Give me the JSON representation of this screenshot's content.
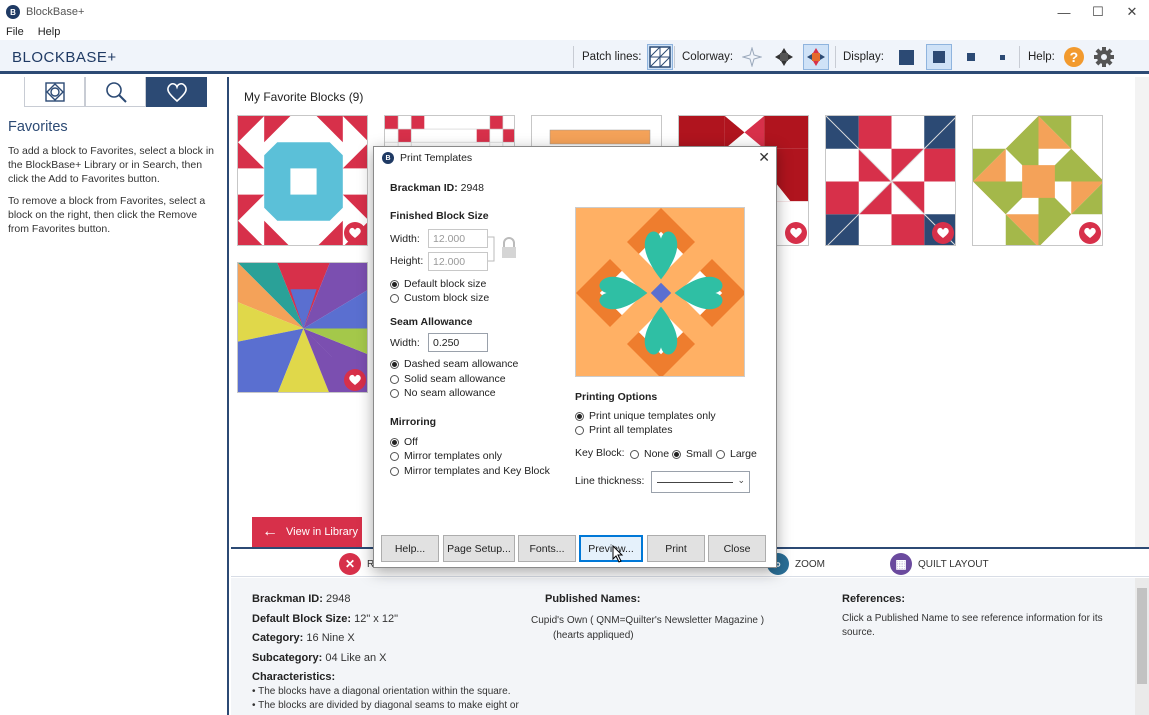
{
  "window": {
    "title": "BlockBase+",
    "controls": [
      "—",
      "☐",
      "✕"
    ]
  },
  "menu": [
    "File",
    "Help"
  ],
  "toolbar": {
    "brand": "BLOCKBASE+",
    "patch_lines_label": "Patch lines:",
    "colorway_label": "Colorway:",
    "display_label": "Display:",
    "help_label": "Help:",
    "help_icon": "?",
    "accent": "#2c4a74",
    "help_color": "#f29a2e"
  },
  "left_panel": {
    "tabs": [
      "library-icon",
      "search-icon",
      "heart-icon"
    ],
    "active_tab": 2,
    "heading": "Favorites",
    "para1": "To add a block to Favorites, select a block in the BlockBase+ Library or in Search, then click the Add to Favorites button.",
    "para2": "To remove a block from Favorites, select a block on the right, then click the Remove from Favorites button."
  },
  "main": {
    "heading": "My Favorite Blocks (9)",
    "view_library_label": "View in Library",
    "heart_color": "#d7304a"
  },
  "actions": [
    {
      "label": "R",
      "icon": "✕",
      "color": "#d7304a"
    },
    {
      "label": "ZOOM",
      "icon": "⌕",
      "color": "#2a6f97"
    },
    {
      "label": "QUILT LAYOUT",
      "icon": "▦",
      "color": "#6b4a9e"
    }
  ],
  "details": {
    "brackman_label": "Brackman ID:",
    "brackman_value": "2948",
    "size_label": "Default Block Size:",
    "size_value": "12\" x 12\"",
    "category_label": "Category:",
    "category_value": "16 Nine X",
    "subcategory_label": "Subcategory:",
    "subcategory_value": "04 Like an X",
    "characteristics_label": "Characteristics:",
    "char1": "• The blocks have a diagonal orientation within the square.",
    "char2": "• The blocks are divided by diagonal seams to make eight or",
    "published_label": "Published Names:",
    "published_name": "Cupid's Own ( QNM=Quilter's Newsletter Magazine )",
    "published_note": "(hearts appliqued)",
    "references_label": "References:",
    "references_text1": "Click a Published Name to see reference information for its",
    "references_text2": "source."
  },
  "dialog": {
    "title": "Print Templates",
    "close": "✕",
    "brackman_label": "Brackman ID:",
    "brackman_value": "2948",
    "finished_heading": "Finished Block Size",
    "width_label": "Width:",
    "width_value": "12.000",
    "height_label": "Height:",
    "height_value": "12.000",
    "size_options": [
      {
        "label": "Default block size",
        "checked": true
      },
      {
        "label": "Custom block size",
        "checked": false
      }
    ],
    "seam_heading": "Seam Allowance",
    "seam_width_label": "Width:",
    "seam_width_value": "0.250",
    "seam_options": [
      {
        "label": "Dashed seam allowance",
        "checked": true
      },
      {
        "label": "Solid seam allowance",
        "checked": false
      },
      {
        "label": "No seam allowance",
        "checked": false
      }
    ],
    "mirroring_heading": "Mirroring",
    "mirror_options": [
      {
        "label": "Off",
        "checked": true
      },
      {
        "label": "Mirror templates only",
        "checked": false
      },
      {
        "label": "Mirror templates and Key Block",
        "checked": false
      }
    ],
    "printing_heading": "Printing Options",
    "print_options": [
      {
        "label": "Print unique templates only",
        "checked": true
      },
      {
        "label": "Print all templates",
        "checked": false
      }
    ],
    "key_block_label": "Key Block:",
    "key_block_options": [
      {
        "label": "None",
        "checked": false
      },
      {
        "label": "Small",
        "checked": true
      },
      {
        "label": "Large",
        "checked": false
      }
    ],
    "line_thickness_label": "Line thickness:",
    "buttons": [
      "Help...",
      "Page Setup...",
      "Fonts...",
      "Preview...",
      "Print",
      "Close"
    ],
    "focused_button": 3
  }
}
